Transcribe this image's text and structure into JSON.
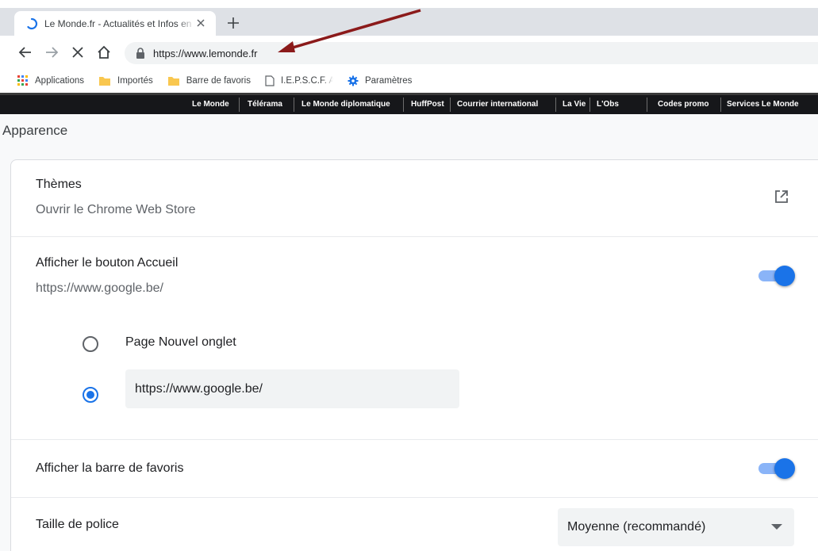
{
  "browser": {
    "tab": {
      "title": "Le Monde.fr - Actualités et Infos en France et dans le monde",
      "favicon": "loading-spinner-icon",
      "close_icon": "close-icon"
    },
    "new_tab_icon": "plus-icon",
    "nav": {
      "back_icon": "arrow-left-icon",
      "forward_icon": "arrow-right-icon",
      "stop_icon": "close-icon",
      "home_icon": "home-icon"
    },
    "address": {
      "lock_icon": "lock-icon",
      "url": "https://www.lemonde.fr"
    },
    "bookmarks": [
      {
        "label": "Applications",
        "icon": "apps-grid-icon"
      },
      {
        "label": "Importés",
        "icon": "folder-icon"
      },
      {
        "label": "Barre de favoris",
        "icon": "folder-icon"
      },
      {
        "label": "I.E.P.S.C.F. Arlon-Athus",
        "icon": "page-icon"
      },
      {
        "label": "Paramètres",
        "icon": "gear-icon"
      }
    ]
  },
  "site_nav": {
    "links": [
      "Le Monde",
      "Télérama",
      "Le Monde diplomatique",
      "HuffPost",
      "Courrier international",
      "La Vie",
      "L'Obs",
      "Codes promo",
      "Services Le Monde"
    ]
  },
  "settings": {
    "section_title": "Apparence",
    "themes": {
      "title": "Thèmes",
      "subtitle": "Ouvrir le Chrome Web Store",
      "icon": "open-in-new-icon"
    },
    "home_button": {
      "title": "Afficher le bouton Accueil",
      "subtitle": "https://www.google.be/",
      "enabled": true,
      "options": [
        {
          "label": "Page Nouvel onglet",
          "checked": false
        },
        {
          "label": "https://www.google.be/",
          "checked": true
        }
      ],
      "custom_url_value": "https://www.google.be/"
    },
    "bookmarks_bar": {
      "title": "Afficher la barre de favoris",
      "enabled": true
    },
    "font_size": {
      "title": "Taille de police",
      "selected": "Moyenne (recommandé)"
    }
  },
  "colors": {
    "accent": "#1a73e8",
    "toggle_track": "#8ab4f8",
    "annotation_arrow": "#8b1a1a",
    "site_bar": "#16171a"
  }
}
